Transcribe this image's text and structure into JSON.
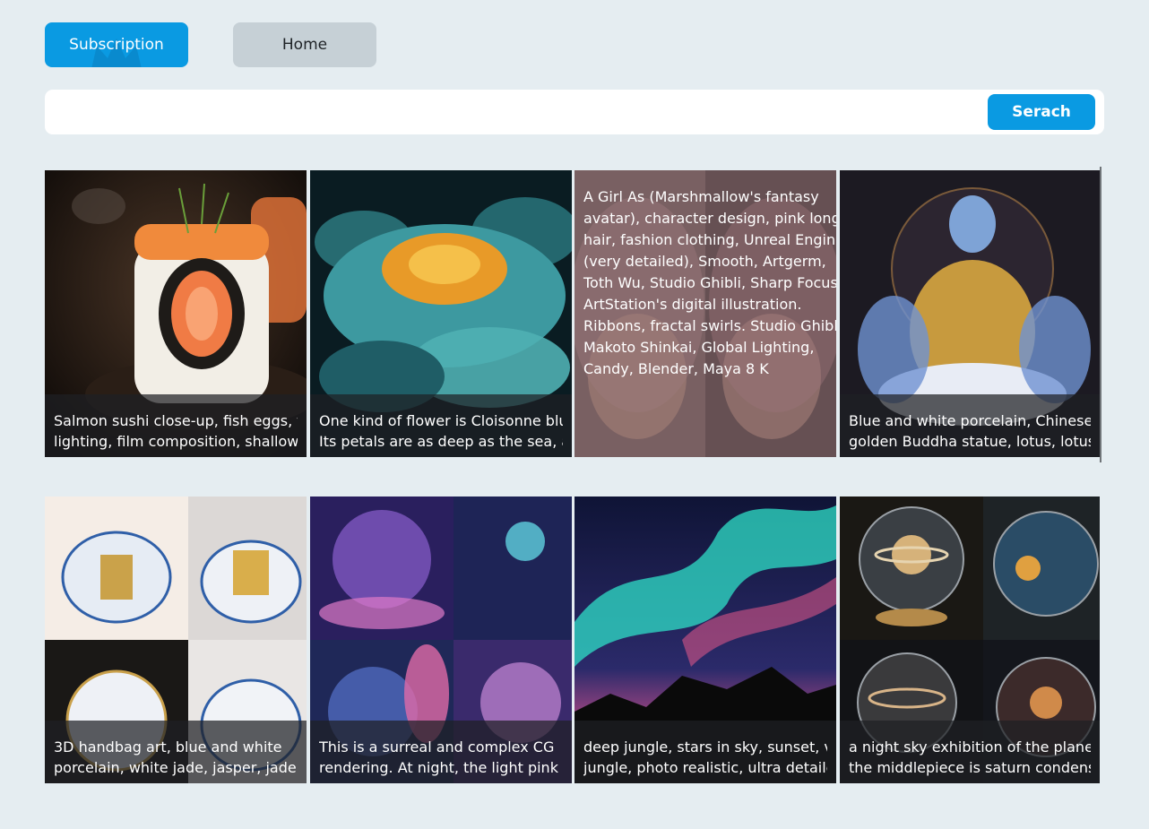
{
  "header": {
    "subscription_label": "Subscription",
    "home_label": "Home"
  },
  "search": {
    "value": "",
    "placeholder": "",
    "button_label": "Serach"
  },
  "colors": {
    "accent": "#0a9ae2",
    "secondary_button": "#c6d0d6",
    "page_background": "#e5edf1"
  },
  "cards": [
    {
      "caption_lines": [
        "Salmon sushi close-up, fish eggs, film",
        "lighting, film composition, shallow"
      ],
      "image": "salmon-sushi-image"
    },
    {
      "caption_lines": [
        "One kind of flower is Cloisonne blue.",
        "Its petals are as deep as the sea, and"
      ],
      "image": "cloisonne-flower-image"
    },
    {
      "overlay_lines": [
        "A Girl As (Marshmallow's fantasy",
        "avatar), character design, pink long",
        "hair, fashion clothing, Unreal Engine",
        "(very detailed), Smooth, Artgerm,",
        "Toth Wu, Studio Ghibli, Sharp Focus",
        "ArtStation's digital illustration.",
        "Ribbons, fractal swirls. Studio Ghibli",
        "Makoto Shinkai, Global Lighting,",
        "Candy, Blender, Maya 8 K"
      ],
      "image": "pink-hair-girl-image"
    },
    {
      "caption_lines": [
        "Blue and white porcelain, Chinese",
        "golden Buddha statue, lotus, lotus,"
      ],
      "image": "porcelain-buddha-image"
    },
    {
      "caption_lines": [
        "3D handbag art, blue and white",
        "porcelain, white jade, jasper, jadeite"
      ],
      "image": "porcelain-handbag-image"
    },
    {
      "caption_lines": [
        "This is a surreal and complex CG",
        "rendering. At night, the light pink sky"
      ],
      "image": "surreal-night-image"
    },
    {
      "caption_lines": [
        "deep jungle, stars in sky, sunset, vast",
        "jungle, photo realistic, ultra detailed"
      ],
      "image": "aurora-jungle-image"
    },
    {
      "caption_lines": [
        "a night sky exhibition of the planets,",
        "the middlepiece is saturn condensed"
      ],
      "image": "planet-globes-image"
    }
  ]
}
